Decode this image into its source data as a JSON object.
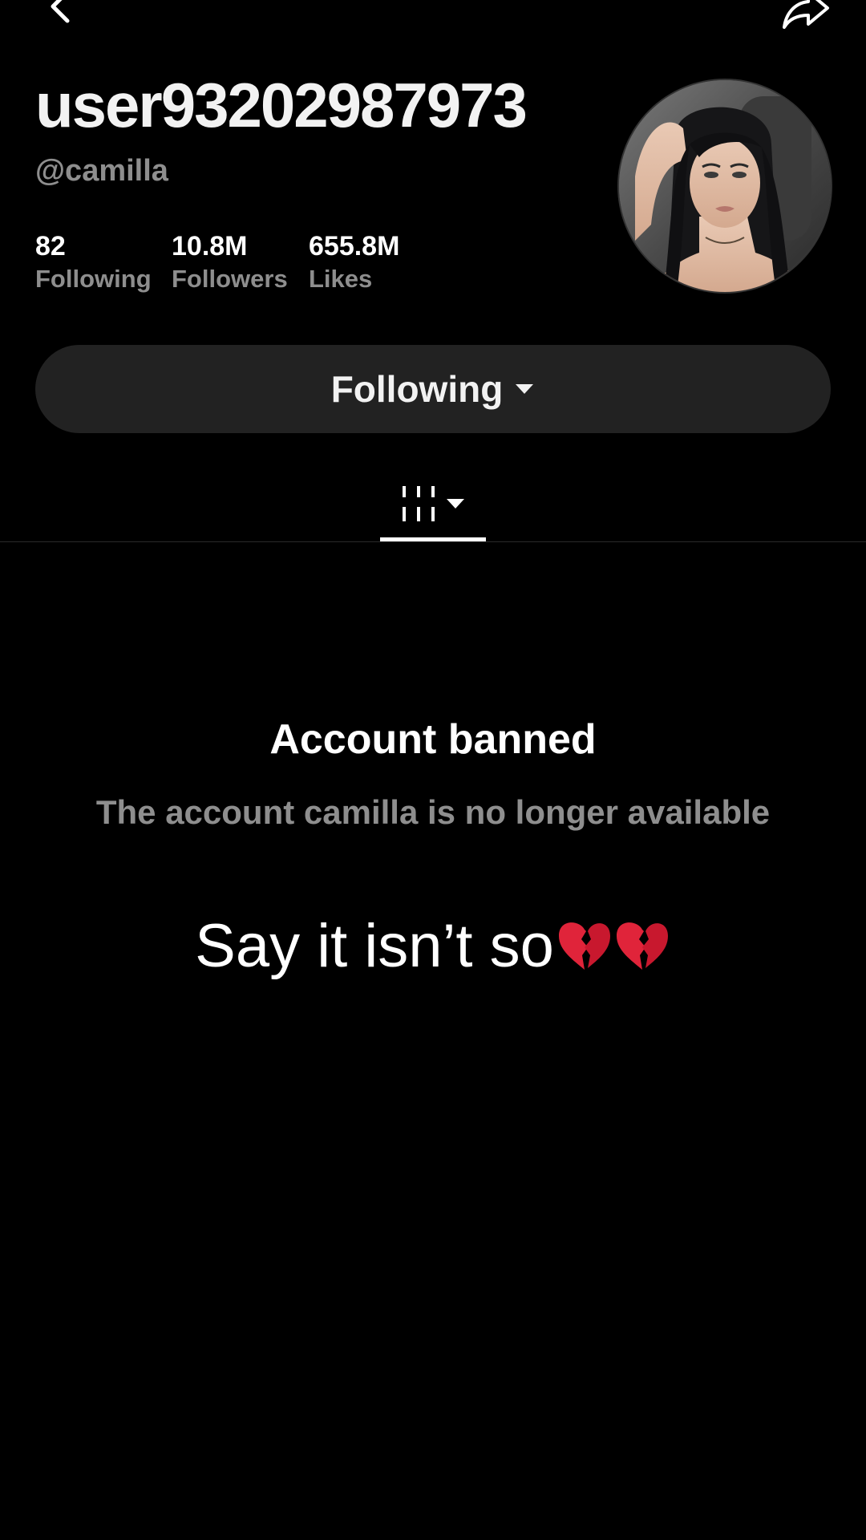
{
  "profile": {
    "display_name": "user93202987973",
    "handle": "@camilla",
    "stats": [
      {
        "value": "82",
        "label": "Following"
      },
      {
        "value": "10.8M",
        "label": "Followers"
      },
      {
        "value": "655.8M",
        "label": "Likes"
      }
    ]
  },
  "follow_button": {
    "label": "Following"
  },
  "banned": {
    "title": "Account banned",
    "subtitle": "The account camilla is no longer available"
  },
  "caption": {
    "text": "Say it isn’t so",
    "emojis": "💔💔"
  },
  "icons": {
    "back": "chevron-left-icon",
    "share": "share-arrow-icon",
    "tab": "video-grid-icon",
    "dropdown": "caret-down-icon",
    "broken_heart": "broken-heart-icon"
  },
  "colors": {
    "background": "#000000",
    "button_bg": "#222222",
    "muted_text": "#8e8e8e",
    "broken_heart": "#e0243a"
  }
}
